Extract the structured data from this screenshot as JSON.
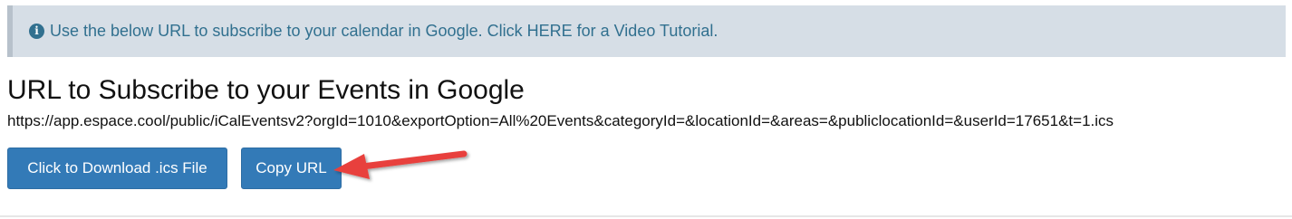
{
  "banner": {
    "icon": "info-circle-icon",
    "text_before": "Use the below URL to subscribe to your calendar in Google. Click ",
    "link_text": "HERE",
    "text_after": " for a Video Tutorial.",
    "color": "#31708f",
    "background": "#d6dee6"
  },
  "heading": "URL to Subscribe to your Events in Google",
  "subscribe_url": "https://app.espace.cool/public/iCalEventsv2?orgId=1010&exportOption=All%20Events&categoryId=&locationId=&areas=&publiclocationId=&userId=17651&t=1.ics",
  "buttons": {
    "download_label": "Click to Download .ics File",
    "copy_label": "Copy URL",
    "color": "#337ab7"
  },
  "annotation": {
    "arrow_icon": "red-arrow-icon",
    "arrow_color": "#e8413c"
  }
}
